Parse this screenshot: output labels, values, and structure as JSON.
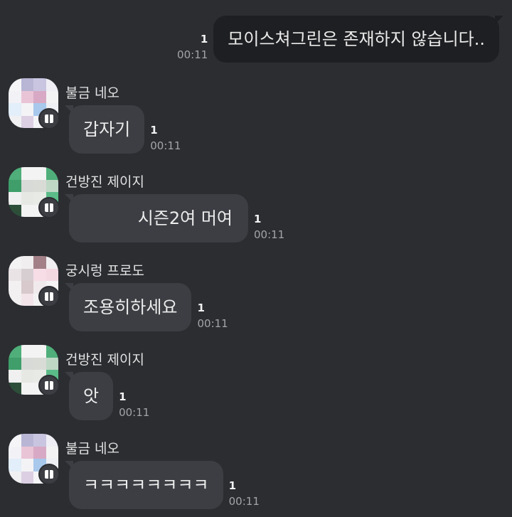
{
  "outgoing": {
    "text": "모이스쳐그린은 존재하지 않습니다..",
    "unread": "1",
    "time": "00:11"
  },
  "messages": [
    {
      "sender": "불금 네오",
      "text": "갑자기",
      "unread": "1",
      "time": "00:11",
      "avatar_palette": [
        "#f5f5f7",
        "#b8b6d4",
        "#c9c5e0",
        "#efeef5",
        "#f2f2f6",
        "#e9c4d6",
        "#d7a9c4",
        "#f3f3f3",
        "#e2eef9",
        "#f3f3f5",
        "#a8c8ec",
        "#eef0f4",
        "#f0f0f2",
        "#dccfe3",
        "#f4f4f6",
        "#f1f1f3"
      ]
    },
    {
      "sender": "건방진 제이지",
      "text": "시즌2여 머여",
      "unread": "1",
      "time": "00:11",
      "avatar_palette": [
        "#4fae7a",
        "#f3f3f3",
        "#f3f3f3",
        "#4fae7a",
        "#3f9e6a",
        "#d7dad6",
        "#d8dbd6",
        "#bfd8c6",
        "#f0f0f0",
        "#e6e8e4",
        "#e8eae6",
        "#5bbb88",
        "#2d4f3a",
        "#f3f3f3",
        "#f3f3f3",
        "#4fae7a"
      ]
    },
    {
      "sender": "궁시렁 프로도",
      "text": "조용히하세요",
      "unread": "1",
      "time": "00:11",
      "avatar_palette": [
        "#f3f3f4",
        "#f1eef0",
        "#a38088",
        "#f0eef0",
        "#e9e3e5",
        "#d7ced2",
        "#f7dde6",
        "#f3d8e2",
        "#f3f0f1",
        "#d8c9cd",
        "#f1eaec",
        "#f6f3f4",
        "#f2f0f1",
        "#f3e4ea",
        "#f2f2f2",
        "#f3f3f3"
      ]
    },
    {
      "sender": "건방진 제이지",
      "text": "앗",
      "unread": "1",
      "time": "00:11",
      "avatar_palette": [
        "#4fae7a",
        "#f3f3f3",
        "#f3f3f3",
        "#4fae7a",
        "#3f9e6a",
        "#d7dad6",
        "#d8dbd6",
        "#bfd8c6",
        "#f0f0f0",
        "#e6e8e4",
        "#e8eae6",
        "#5bbb88",
        "#2d4f3a",
        "#f3f3f3",
        "#f3f3f3",
        "#4fae7a"
      ]
    },
    {
      "sender": "불금 네오",
      "text": "ㅋㅋㅋㅋㅋㅋㅋㅋ",
      "unread": "1",
      "time": "00:11",
      "avatar_palette": [
        "#f5f5f7",
        "#b8b6d4",
        "#c9c5e0",
        "#efeef5",
        "#f2f2f6",
        "#e9c4d6",
        "#d7a9c4",
        "#f3f3f3",
        "#e2eef9",
        "#f3f3f5",
        "#a8c8ec",
        "#eef0f4",
        "#f0f0f2",
        "#dccfe3",
        "#f4f4f6",
        "#f1f1f3"
      ]
    }
  ]
}
